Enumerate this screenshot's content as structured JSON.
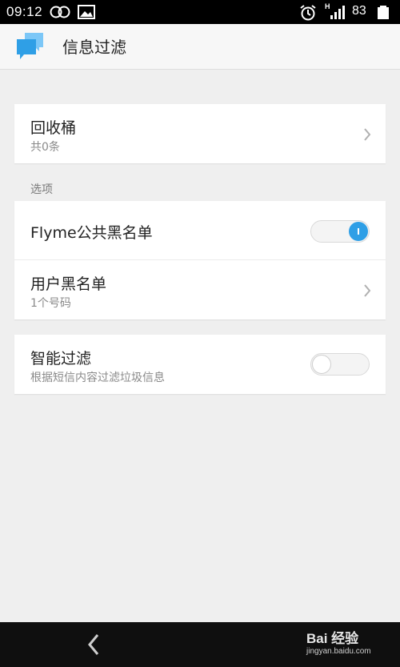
{
  "status_bar": {
    "time": "09:12",
    "network_type": "H",
    "battery_level": "83",
    "icons": [
      "rings-icon",
      "gallery-icon",
      "alarm-icon",
      "signal-icon",
      "battery-icon"
    ]
  },
  "header": {
    "title": "信息过滤",
    "logo_icon": "message-bubbles-icon",
    "logo_color": "#3aa6ee"
  },
  "trash": {
    "title": "回收桶",
    "subtitle": "共0条"
  },
  "options_section": {
    "label": "选项"
  },
  "options": {
    "flyme_blacklist": {
      "title": "Flyme公共黑名单",
      "enabled": true
    },
    "user_blacklist": {
      "title": "用户黑名单",
      "subtitle": "1个号码"
    }
  },
  "smart_filter": {
    "title": "智能过滤",
    "subtitle": "根据短信内容过滤垃圾信息",
    "enabled": false
  },
  "nav_bar": {
    "back_icon": "back-arrow-icon"
  },
  "watermark": {
    "brand": "Bai 经验",
    "url": "jingyan.baidu.com"
  },
  "colors": {
    "accent": "#2f9fe6",
    "background": "#efefef"
  }
}
